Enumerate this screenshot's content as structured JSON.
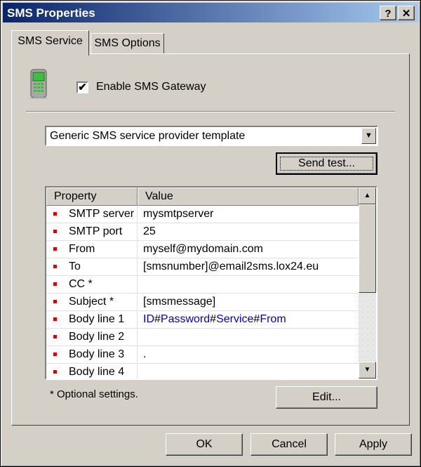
{
  "window": {
    "title": "SMS Properties"
  },
  "titlebar_buttons": {
    "help": "?",
    "close": "✕"
  },
  "tabs": [
    {
      "label": "SMS Service",
      "active": true
    },
    {
      "label": "SMS Options",
      "active": false
    }
  ],
  "gateway": {
    "icon": "phone-icon",
    "checkbox_label": "Enable SMS Gateway",
    "checked": true,
    "check_mark": "✔"
  },
  "provider": {
    "selected": "Generic SMS service provider template",
    "arrow": "▼"
  },
  "buttons": {
    "send_test": "Send test...",
    "edit": "Edit...",
    "ok": "OK",
    "cancel": "Cancel",
    "apply": "Apply"
  },
  "grid": {
    "columns": [
      "Property",
      "Value"
    ],
    "rows": [
      {
        "property": "SMTP server",
        "value": "mysmtpserver"
      },
      {
        "property": "SMTP port",
        "value": "25"
      },
      {
        "property": "From",
        "value": "myself@mydomain.com"
      },
      {
        "property": "To",
        "value": "[smsnumber]@email2sms.lox24.eu"
      },
      {
        "property": "CC *",
        "value": ""
      },
      {
        "property": "Subject *",
        "value": "[smsmessage]"
      },
      {
        "property": "Body line 1",
        "value_parts": [
          "ID",
          "#",
          "Password",
          "#",
          "Service",
          "#",
          "From"
        ]
      },
      {
        "property": "Body line 2",
        "value": ""
      },
      {
        "property": "Body line 3",
        "value": "."
      },
      {
        "property": "Body line 4",
        "value": ""
      }
    ],
    "scroll_up": "▲",
    "scroll_down": "▼"
  },
  "footnote": "* Optional settings.",
  "colors": {
    "title_start": "#0a246a",
    "title_end": "#a6caf0",
    "bullet": "#e00000",
    "link_blue": "#0000cc"
  }
}
